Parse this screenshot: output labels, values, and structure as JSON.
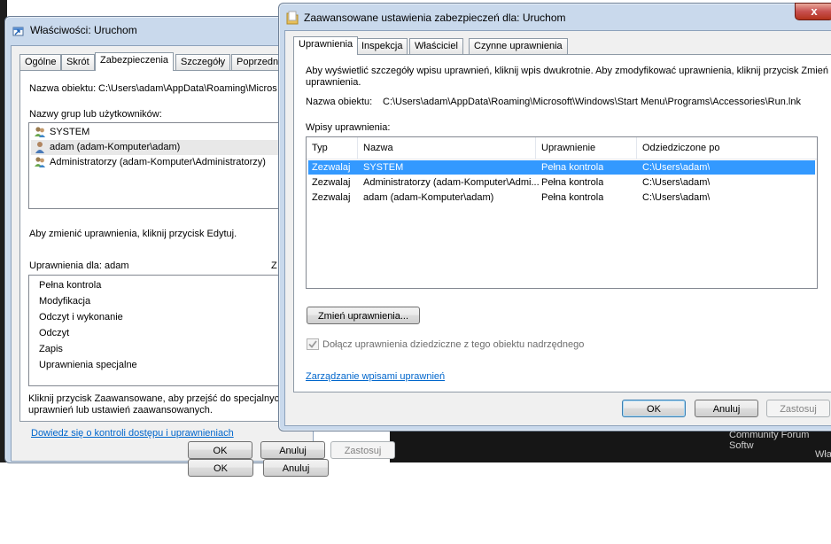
{
  "background": {
    "texts": [
      "Community Forum Softw",
      "Wła"
    ]
  },
  "props_window": {
    "title": "Właściwości: Uruchom",
    "tabs": [
      "Ogólne",
      "Skrót",
      "Zabezpieczenia",
      "Szczegóły",
      "Poprzedni"
    ],
    "active_tab": "Zabezpieczenia",
    "object_label": "Nazwa obiektu:",
    "object_value": "C:\\Users\\adam\\AppData\\Roaming\\Micros",
    "groups_label": "Nazwy grup lub użytkowników:",
    "groups": [
      {
        "name": "SYSTEM",
        "icon": "group-icon"
      },
      {
        "name": "adam (adam-Komputer\\adam)",
        "icon": "user-icon"
      },
      {
        "name": "Administratorzy (adam-Komputer\\Administratorzy)",
        "icon": "group-icon"
      }
    ],
    "edit_hint": "Aby zmienić uprawnienia, kliknij przycisk Edytuj.",
    "perms_label": "Uprawnienia dla: adam",
    "perms_col_cut": "Z",
    "perms": [
      "Pełna kontrola",
      "Modyfikacja",
      "Odczyt i wykonanie",
      "Odczyt",
      "Zapis",
      "Uprawnienia specjalne"
    ],
    "advanced_hint_1": "Kliknij przycisk Zaawansowane, aby przejść do specjalnych",
    "advanced_hint_2": "uprawnień lub ustawień zaawansowanych.",
    "learn_link": "Dowiedz się o kontroli dostępu i uprawnieniach",
    "ok": "OK",
    "cancel": "Anuluj",
    "apply": "Zastosuj"
  },
  "adv_window": {
    "title": "Zaawansowane ustawienia zabezpieczeń dla: Uruchom",
    "close": "x",
    "tabs": [
      "Uprawnienia",
      "Inspekcja",
      "Właściciel",
      "Czynne uprawnienia"
    ],
    "active_tab": "Uprawnienia",
    "hint_1": "Aby wyświetlić szczegóły wpisu uprawnień, kliknij wpis dwukrotnie. Aby zmodyfikować uprawnienia, kliknij przycisk Zmień",
    "hint_2": "uprawnienia.",
    "object_label": "Nazwa obiektu:",
    "object_value": "C:\\Users\\adam\\AppData\\Roaming\\Microsoft\\Windows\\Start Menu\\Programs\\Accessories\\Run.lnk",
    "entries_label": "Wpisy uprawnienia:",
    "columns": [
      "Typ",
      "Nazwa",
      "Uprawnienie",
      "Odziedziczone po"
    ],
    "rows": [
      {
        "type": "Zezwalaj",
        "name": "SYSTEM",
        "perm": "Pełna kontrola",
        "inherited": "C:\\Users\\adam\\",
        "selected": true
      },
      {
        "type": "Zezwalaj",
        "name": "Administratorzy (adam-Komputer\\Admi...",
        "perm": "Pełna kontrola",
        "inherited": "C:\\Users\\adam\\",
        "selected": false
      },
      {
        "type": "Zezwalaj",
        "name": "adam (adam-Komputer\\adam)",
        "perm": "Pełna kontrola",
        "inherited": "C:\\Users\\adam\\",
        "selected": false
      }
    ],
    "change_button": "Zmień uprawnienia...",
    "inherit_checkbox": {
      "label": "Dołącz uprawnienia dziedziczne z tego obiektu nadrzędnego",
      "checked": true,
      "enabled": false
    },
    "manage_link": "Zarządzanie wpisami uprawnień",
    "ok": "OK",
    "cancel": "Anuluj",
    "apply": "Zastosuj"
  }
}
